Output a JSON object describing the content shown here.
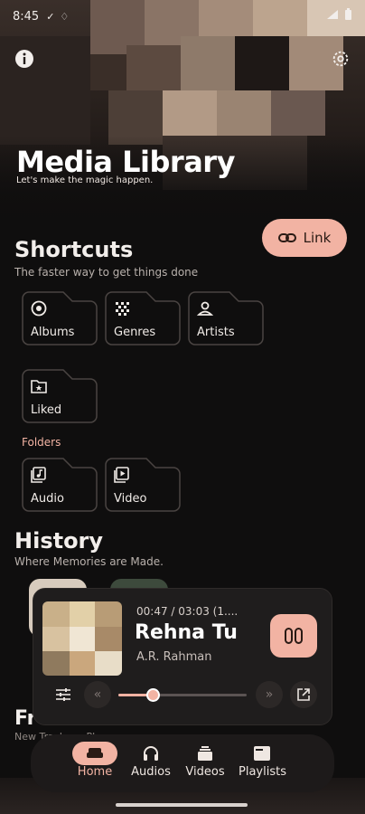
{
  "status_bar": {
    "time": "8:45"
  },
  "header": {
    "title": "Media Library",
    "tagline": "Let's make the magic happen."
  },
  "link_button": {
    "label": "Link"
  },
  "shortcuts": {
    "title": "Shortcuts",
    "subtitle": "The faster way to get things done",
    "items": [
      {
        "label": "Albums",
        "icon": "album-icon"
      },
      {
        "label": "Genres",
        "icon": "genres-icon"
      },
      {
        "label": "Artists",
        "icon": "artist-icon"
      },
      {
        "label": "Liked",
        "icon": "liked-folder-icon"
      }
    ]
  },
  "folders": {
    "label": "Folders",
    "items": [
      {
        "label": "Audio",
        "icon": "audio-file-icon"
      },
      {
        "label": "Video",
        "icon": "video-file-icon"
      }
    ]
  },
  "history": {
    "title": "History",
    "subtitle": "Where Memories are Made."
  },
  "player": {
    "time": "00:47 / 03:03 (1....",
    "song": "Rehna Tu",
    "artist": "A.R. Rahman",
    "progress": 0.27
  },
  "fresh": {
    "title": "Fr",
    "subtitle": "New Tracks ... Pla..."
  },
  "nav": {
    "items": [
      {
        "label": "Home",
        "active": true
      },
      {
        "label": "Audios",
        "active": false
      },
      {
        "label": "Videos",
        "active": false
      },
      {
        "label": "Playlists",
        "active": false
      }
    ]
  },
  "colors": {
    "accent": "#f2b3a3",
    "background": "#0f0e0e",
    "surface": "#1f1d1d"
  }
}
